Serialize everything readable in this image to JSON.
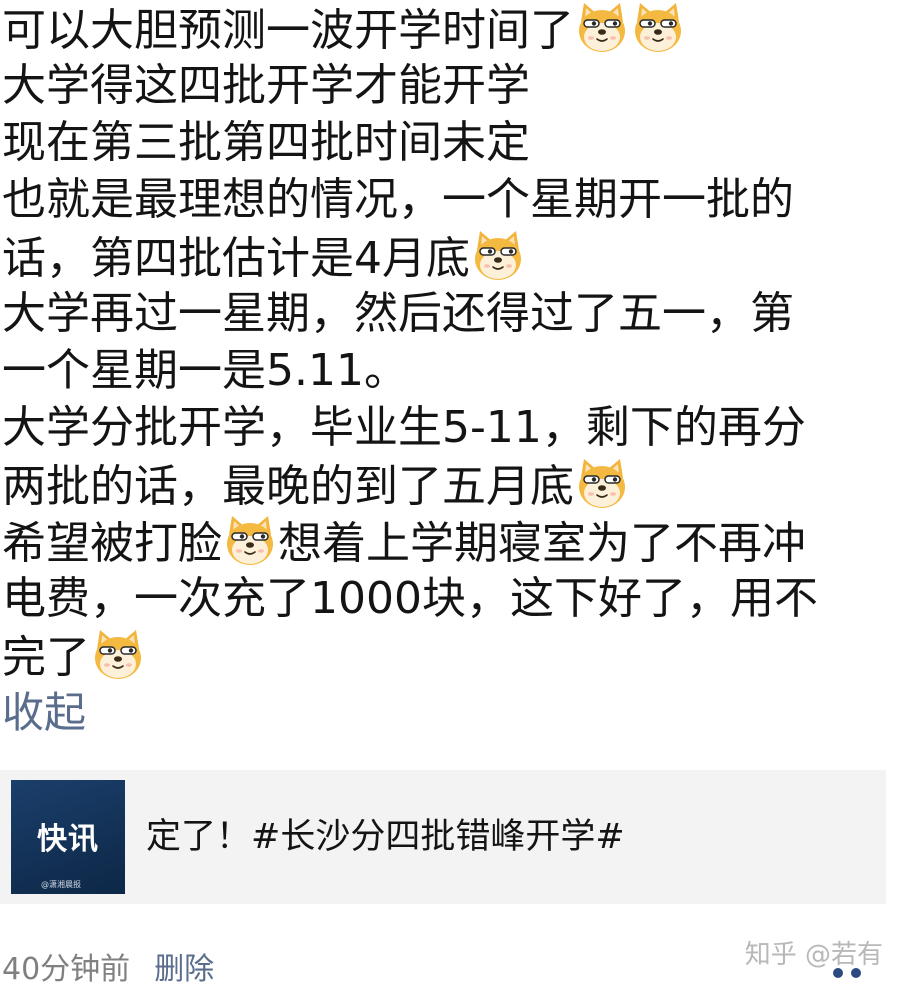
{
  "post": {
    "lines": [
      "可以大胆预测一波开学时间了",
      "大学得这四批开学才能开学",
      "现在第三批第四批时间未定",
      "也就是最理想的情况，一个星期开一批的",
      "话，第四批估计是4月底",
      "大学再过一星期，然后还得过了五一，第",
      "一个星期一是5.11。",
      "大学分批开学，毕业生5-11，剩下的再分",
      "两批的话，最晚的到了五月底",
      "希望被打脸",
      "想着上学期寝室为了不再冲",
      "电费，一次充了1000块，这下好了，用不",
      "完了"
    ],
    "emoji_icon": "doge-emoji-icon",
    "collapse_label": "收起"
  },
  "repost": {
    "thumb_title": "快讯",
    "thumb_source": "@潇湘晨报",
    "text": "定了！#长沙分四批错峰开学#"
  },
  "meta": {
    "time": "40分钟前",
    "delete_label": "删除"
  },
  "watermark": "知乎 @若有",
  "colors": {
    "link": "#5a6d8c",
    "card_bg": "#f3f3f3",
    "thumb_bg": "#1b3f6b",
    "dots": "#2d4a80"
  }
}
